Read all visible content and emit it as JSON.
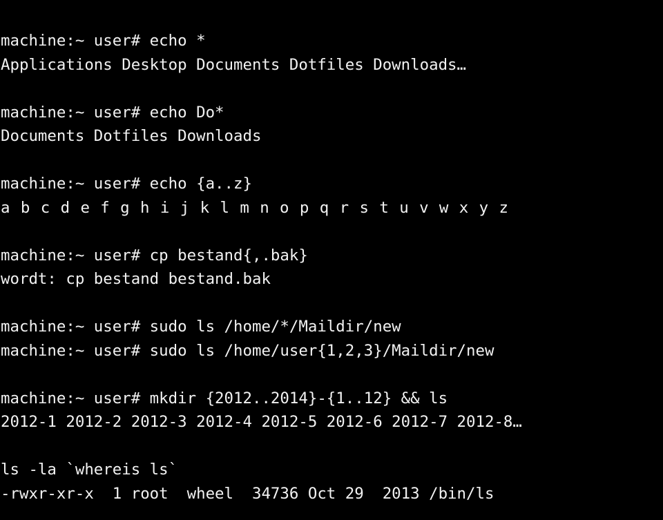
{
  "terminal": {
    "title": "bash shell session",
    "colors": {
      "background": "#000000",
      "foreground": "#f2f2f2"
    },
    "prompt": "machine:~ user#",
    "lines": [
      {
        "id": "line-1",
        "kind": "command",
        "text": "machine:~ user# echo *"
      },
      {
        "id": "line-2",
        "kind": "output",
        "text": "Applications Desktop Documents Dotfiles Downloads…"
      },
      {
        "id": "line-3",
        "kind": "blank",
        "text": ""
      },
      {
        "id": "line-4",
        "kind": "command",
        "text": "machine:~ user# echo Do*"
      },
      {
        "id": "line-5",
        "kind": "output",
        "text": "Documents Dotfiles Downloads"
      },
      {
        "id": "line-6",
        "kind": "blank",
        "text": ""
      },
      {
        "id": "line-7",
        "kind": "command",
        "text": "machine:~ user# echo {a..z}"
      },
      {
        "id": "line-8",
        "kind": "output",
        "text": "a b c d e f g h i j k l m n o p q r s t u v w x y z"
      },
      {
        "id": "line-9",
        "kind": "blank",
        "text": ""
      },
      {
        "id": "line-10",
        "kind": "command",
        "text": "machine:~ user# cp bestand{,.bak}"
      },
      {
        "id": "line-11",
        "kind": "output",
        "text": "wordt: cp bestand bestand.bak"
      },
      {
        "id": "line-12",
        "kind": "blank",
        "text": ""
      },
      {
        "id": "line-13",
        "kind": "command",
        "text": "machine:~ user# sudo ls /home/*/Maildir/new"
      },
      {
        "id": "line-14",
        "kind": "command",
        "text": "machine:~ user# sudo ls /home/user{1,2,3}/Maildir/new"
      },
      {
        "id": "line-15",
        "kind": "blank",
        "text": ""
      },
      {
        "id": "line-16",
        "kind": "command",
        "text": "machine:~ user# mkdir {2012..2014}-{1..12} && ls"
      },
      {
        "id": "line-17",
        "kind": "output",
        "text": "2012-1 2012-2 2012-3 2012-4 2012-5 2012-6 2012-7 2012-8…"
      },
      {
        "id": "line-18",
        "kind": "blank",
        "text": ""
      },
      {
        "id": "line-19",
        "kind": "command",
        "text": "ls -la `whereis ls`"
      },
      {
        "id": "line-20",
        "kind": "output",
        "text": "-rwxr-xr-x  1 root  wheel  34736 Oct 29  2013 /bin/ls"
      }
    ]
  }
}
